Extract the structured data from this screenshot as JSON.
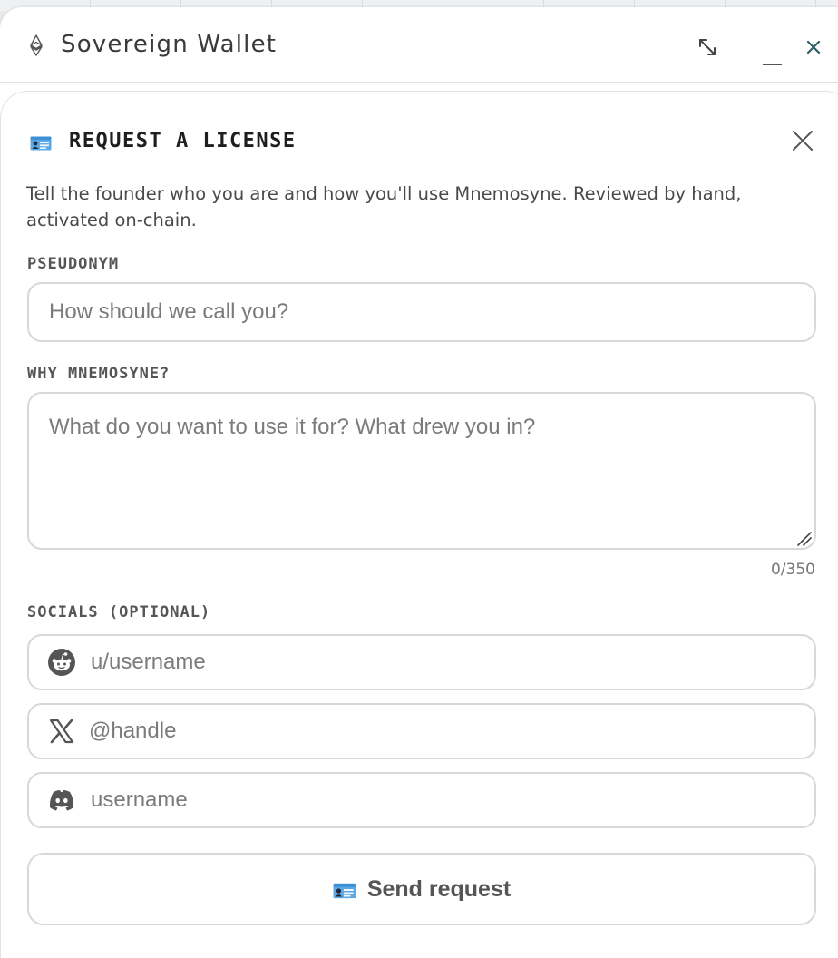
{
  "window": {
    "title": "Sovereign Wallet",
    "icon": "ethereum-icon",
    "controls": [
      "expand-icon",
      "minimize-icon",
      "close-icon"
    ]
  },
  "panel": {
    "title": "REQUEST A LICENSE",
    "title_icon": "id-card-icon",
    "intro": "Tell the founder who you are and how you'll use Mnemosyne. Reviewed by hand, activated on-chain.",
    "pseudonym": {
      "label": "PSEUDONYM",
      "value": "",
      "placeholder": "How should we call you?"
    },
    "why": {
      "label": "WHY MNEMOSYNE?",
      "value": "",
      "placeholder": "What do you want to use it for? What drew you in?",
      "counter": "0/350"
    },
    "socials": {
      "label": "SOCIALS (OPTIONAL)",
      "reddit": {
        "icon": "reddit-icon",
        "placeholder": "u/username",
        "value": ""
      },
      "x": {
        "icon": "x-icon",
        "placeholder": "@handle",
        "value": ""
      },
      "discord": {
        "icon": "discord-icon",
        "placeholder": "username",
        "value": ""
      }
    },
    "submit": {
      "label": "Send request",
      "icon": "id-card-icon"
    }
  },
  "colors": {
    "id_card_blue": "#5aa9e6",
    "text_dark": "#1e1e1e",
    "border": "#d8d8d8",
    "placeholder": "#7b7b7b"
  }
}
